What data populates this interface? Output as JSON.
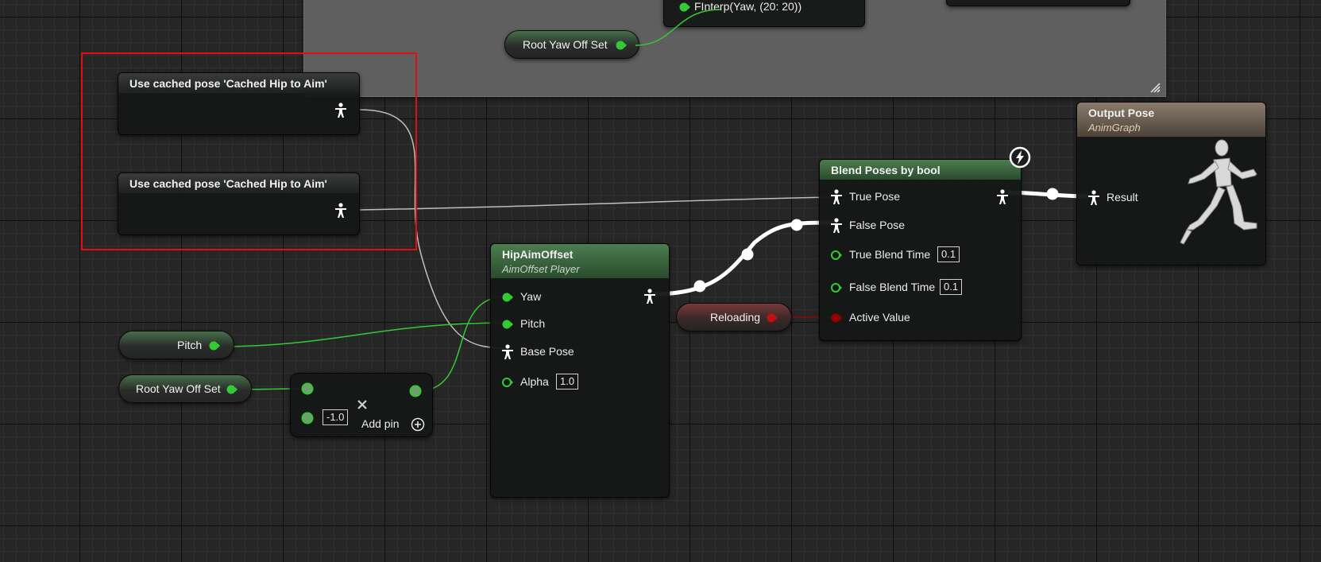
{
  "comment_box": {
    "finterp_label": "FInterp(Yaw, (20: 20))",
    "root_yaw_var": "Root Yaw Off Set"
  },
  "cached_pose_1": {
    "title": "Use cached pose 'Cached Hip to Aim'"
  },
  "cached_pose_2": {
    "title": "Use cached pose 'Cached Hip to Aim'"
  },
  "pitch_var": {
    "label": "Pitch"
  },
  "root_yaw_var": {
    "label": "Root Yaw Off Set"
  },
  "multiply_node": {
    "value": "-1.0",
    "add_pin": "Add pin"
  },
  "hip_aim_offset": {
    "title": "HipAimOffset",
    "subtitle": "AimOffset Player",
    "yaw": "Yaw",
    "pitch": "Pitch",
    "base_pose": "Base Pose",
    "alpha": "Alpha",
    "alpha_value": "1.0"
  },
  "reloading_var": {
    "label": "Reloading"
  },
  "blend_poses": {
    "title": "Blend Poses by bool",
    "true_pose": "True Pose",
    "false_pose": "False Pose",
    "true_blend_time": "True Blend Time",
    "true_blend_value": "0.1",
    "false_blend_time": "False Blend Time",
    "false_blend_value": "0.1",
    "active_value": "Active Value"
  },
  "output_pose": {
    "title": "Output Pose",
    "subtitle": "AnimGraph",
    "result": "Result"
  },
  "colors": {
    "pose_wire": "#ffffff",
    "float_pin": "#35c935",
    "bool_pin": "#950000",
    "selection": "#e01010",
    "blend_header": "#4d7d4f",
    "output_header": "#8a7b6b"
  },
  "icons": {
    "pose_pin": "person-pose-icon",
    "fast_path": "lightning-icon",
    "add_pin": "add-circle-icon",
    "remove": "close-icon",
    "mannequin": "running-mannequin-icon"
  }
}
